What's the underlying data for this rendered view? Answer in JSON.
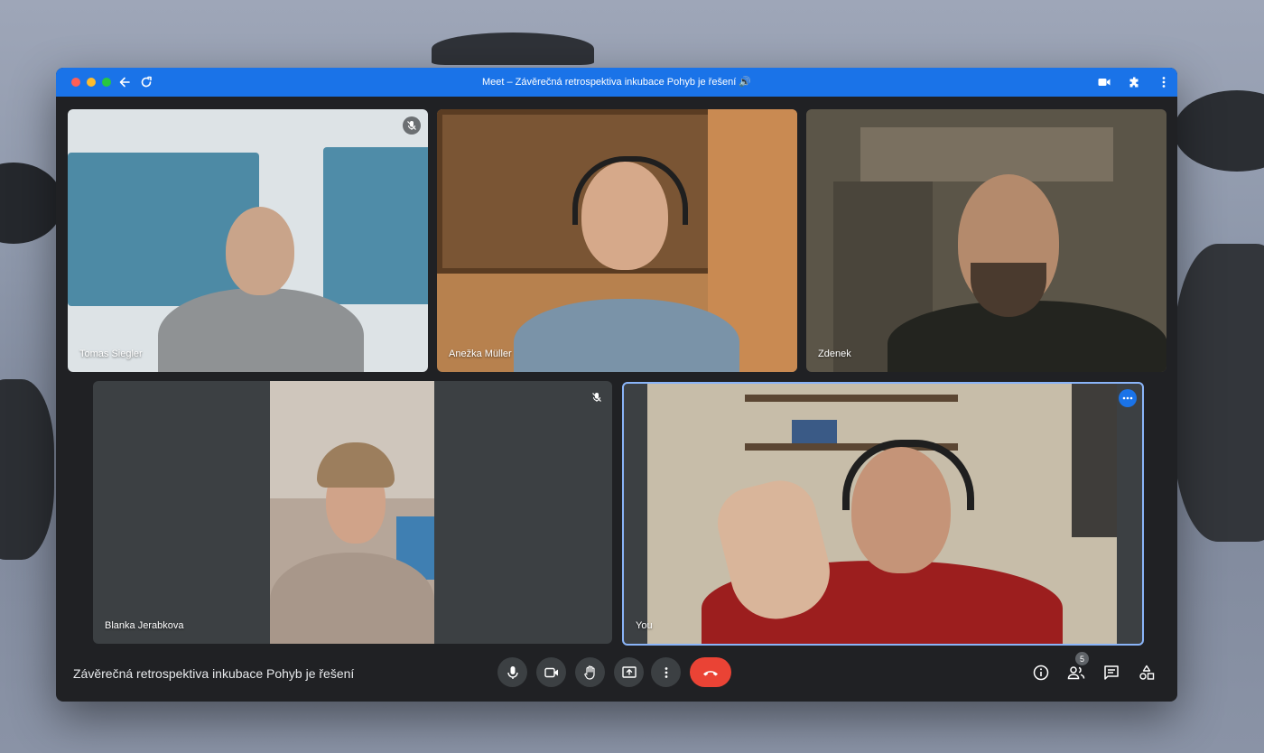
{
  "window": {
    "title": "Meet – Závěrečná retrospektiva inkubace Pohyb je řešení 🔊"
  },
  "participants": [
    {
      "name": "Tomas Siegler",
      "muted": true
    },
    {
      "name": "Anežka Müller",
      "muted": false
    },
    {
      "name": "Zdenek",
      "muted": false
    },
    {
      "name": "Blanka Jerabkova",
      "muted": true
    },
    {
      "name": "You",
      "muted": false,
      "active": true
    }
  ],
  "meeting": {
    "title": "Závěrečná retrospektiva inkubace Pohyb je řešení",
    "participant_count": "5"
  },
  "icons": {
    "mic": "microphone-icon",
    "camera": "camera-icon",
    "hand": "raise-hand-icon",
    "present": "present-screen-icon",
    "more": "more-options-icon",
    "end": "end-call-icon",
    "info": "info-icon",
    "people": "people-icon",
    "chat": "chat-icon",
    "activities": "activities-icon"
  },
  "colors": {
    "titlebar": "#1a73e8",
    "end_call": "#ea4335",
    "active_border": "#8ab4f8"
  }
}
